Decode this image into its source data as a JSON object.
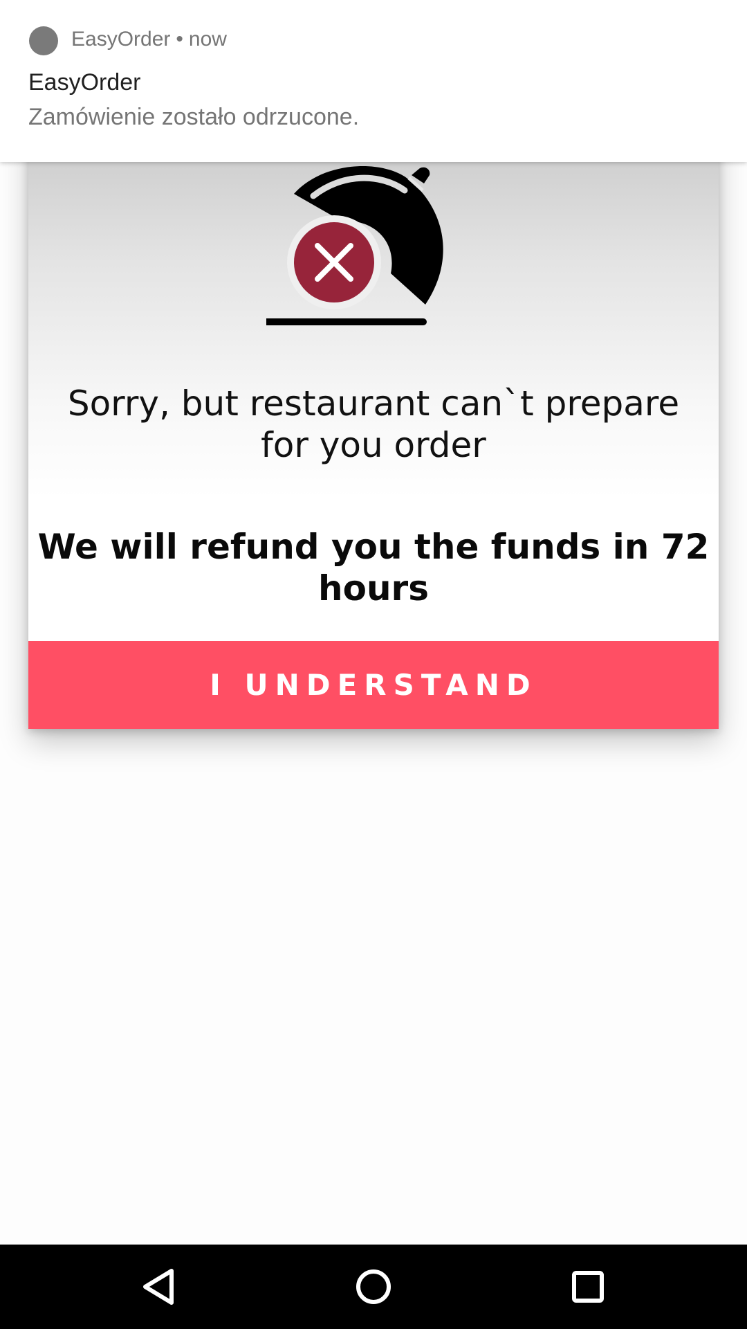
{
  "notification": {
    "app_name": "EasyOrder",
    "separator": "•",
    "time": "now",
    "title": "EasyOrder",
    "text": "Zamówienie zostało odrzucone."
  },
  "dialog": {
    "illustration": "rejected-order-cloche-icon",
    "message": "Sorry, but restaurant can`t prepare for you order",
    "refund_text": "We will refund you the funds in 72 hours",
    "button_label": "I UNDERSTAND",
    "colors": {
      "button": "#ff4f64",
      "reject_circle": "#97243a"
    }
  },
  "navbar": {
    "back": "back-icon",
    "home": "home-icon",
    "recents": "recents-icon"
  }
}
